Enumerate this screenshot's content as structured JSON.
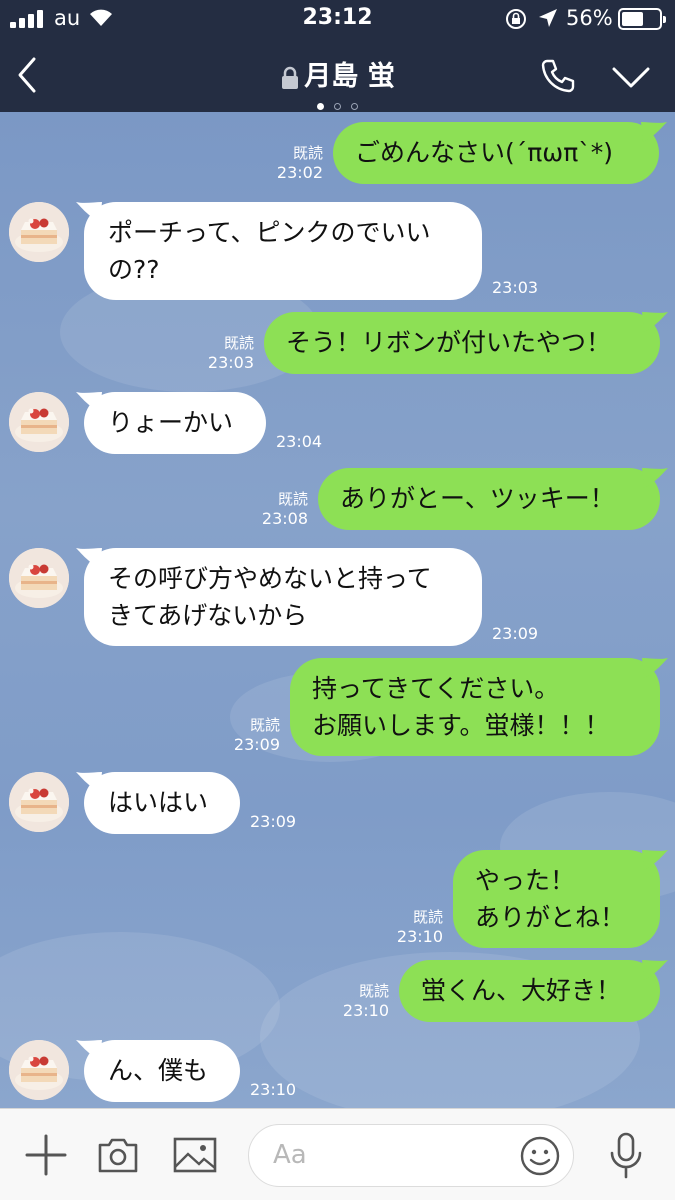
{
  "status_bar": {
    "carrier": "au",
    "time": "23:12",
    "battery_percent": "56%",
    "battery_level": 0.56
  },
  "header": {
    "title": "月島 蛍",
    "page_count": 3,
    "active_page": 1
  },
  "colors": {
    "header_bg": "#242d42",
    "outgoing_bubble": "#8de055",
    "incoming_bubble": "#ffffff",
    "chat_bg": "#7f9cc8"
  },
  "messages": [
    {
      "dir": "out",
      "text": "ごめんなさい(´πωπ`*)",
      "read": "既読",
      "time": "23:02"
    },
    {
      "dir": "in",
      "text": "ポーチって、ピンクのでいい\nの??",
      "time": "23:03"
    },
    {
      "dir": "out",
      "text": "そう！リボンが付いたやつ！",
      "read": "既読",
      "time": "23:03"
    },
    {
      "dir": "in",
      "text": "りょーかい",
      "time": "23:04"
    },
    {
      "dir": "out",
      "text": "ありがとー、ツッキー！",
      "read": "既読",
      "time": "23:08"
    },
    {
      "dir": "in",
      "text": "その呼び方やめないと持って\nきてあげないから",
      "time": "23:09"
    },
    {
      "dir": "out",
      "text": "持ってきてください。\nお願いします。蛍様！！！",
      "read": "既読",
      "time": "23:09"
    },
    {
      "dir": "in",
      "text": "はいはい",
      "time": "23:09"
    },
    {
      "dir": "out",
      "text": "やった！\nありがとね！",
      "read": "既読",
      "time": "23:10"
    },
    {
      "dir": "out",
      "text": "蛍くん、大好き！",
      "read": "既読",
      "time": "23:10"
    },
    {
      "dir": "in",
      "text": "ん、僕も",
      "time": "23:10"
    }
  ],
  "input": {
    "placeholder": "Aa"
  },
  "icons": [
    "back-icon",
    "lock-icon",
    "phone-icon",
    "chevron-down-icon",
    "plus-icon",
    "camera-icon",
    "image-icon",
    "emoji-icon",
    "microphone-icon"
  ]
}
